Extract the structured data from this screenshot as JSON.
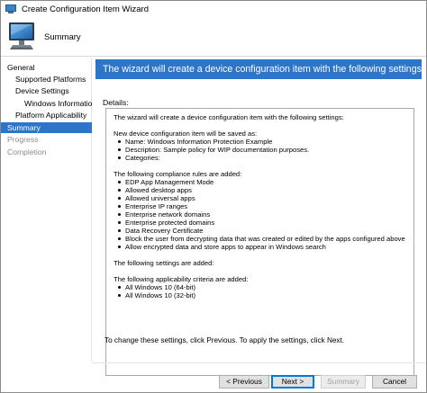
{
  "window": {
    "title": "Create Configuration Item Wizard"
  },
  "header": {
    "title": "Summary"
  },
  "sidebar": {
    "items": [
      {
        "label": "General",
        "state": "normal"
      },
      {
        "label": "Supported Platforms",
        "state": "normal"
      },
      {
        "label": "Device Settings",
        "state": "normal"
      },
      {
        "label": "Windows Information",
        "state": "normal"
      },
      {
        "label": "Platform Applicability",
        "state": "normal"
      },
      {
        "label": "Summary",
        "state": "selected"
      },
      {
        "label": "Progress",
        "state": "inactive"
      },
      {
        "label": "Completion",
        "state": "inactive"
      }
    ]
  },
  "main": {
    "banner": "The wizard will create a device configuration item with the following settings",
    "details_label": "Details:",
    "details": {
      "intro": "The wizard will create a device configuration item with the following settings:",
      "saved_heading": "New device configuration item will be saved as:",
      "saved_items": [
        "Name: Windows Information Protection Example",
        "Description: Sample policy for WIP documentation purposes.",
        "Categories:"
      ],
      "rules_heading": "The following compliance rules are added:",
      "rules": [
        "EDP App Management Mode",
        "Allowed desktop apps",
        "Allowed universal apps",
        "Enterprise IP ranges",
        "Enterprise network domains",
        "Enterprise protected domains",
        "Data Recovery Certificate",
        "Block the user from decrypting data that was created or edited by the apps configured above",
        "Allow encrypted data and store apps to appear in Windows search"
      ],
      "settings_heading": "The following settings are added:",
      "applicability_heading": "The following applicability criteria are added:",
      "applicability": [
        "All Windows 10 (64-bit)",
        "All Windows 10 (32-bit)"
      ]
    },
    "hint": "To change these settings, click Previous. To apply the settings, click Next."
  },
  "footer": {
    "previous": "< Previous",
    "next": "Next >",
    "summary": "Summary",
    "cancel": "Cancel"
  },
  "colors": {
    "accent": "#2e74c8",
    "focus_border": "#0078d7"
  }
}
